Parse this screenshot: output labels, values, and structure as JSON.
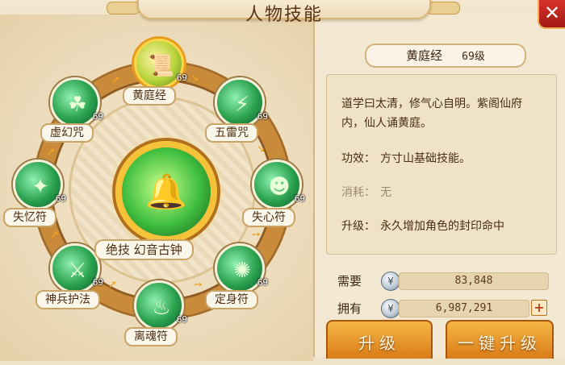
{
  "window": {
    "title": "人物技能",
    "close_icon": "close-icon"
  },
  "skill_wheel": {
    "skills": [
      {
        "name": "黄庭经",
        "level": "69",
        "icon": "scroll-icon",
        "selected": true
      },
      {
        "name": "五雷咒",
        "level": "69",
        "icon": "thunder-icon"
      },
      {
        "name": "失心符",
        "level": "69",
        "icon": "mask-icon"
      },
      {
        "name": "定身符",
        "level": "69",
        "icon": "bind-icon"
      },
      {
        "name": "离魂符",
        "level": "69",
        "icon": "soul-icon"
      },
      {
        "name": "神兵护法",
        "level": "69",
        "icon": "weapon-icon"
      },
      {
        "name": "失忆符",
        "level": "69",
        "icon": "talisman-icon"
      },
      {
        "name": "虚幻咒",
        "level": "69",
        "icon": "illusion-icon"
      }
    ],
    "ultimate": {
      "label": "绝技  幻音古钟",
      "icon": "bell-icon"
    }
  },
  "detail": {
    "title": "黄庭经",
    "level": "69级",
    "description": "道学曰太清，修气心自明。紫阁仙府内，仙人诵黄庭。",
    "effect_label": "功效：",
    "effect_value": "方寸山基础技能。",
    "cost_label": "消耗：",
    "cost_value": "无",
    "upgrade_label": "升级：",
    "upgrade_value": "永久增加角色的封印命中"
  },
  "resources": {
    "required_label": "需要",
    "required_value": "83,848",
    "owned_label": "拥有",
    "owned_value": "6,987,291"
  },
  "buttons": {
    "upgrade": "升级",
    "one_click_upgrade": "一键升级"
  },
  "colors": {
    "accent": "#d97b17",
    "ring": "#c98b3a",
    "skill_green": "#2aa24f"
  }
}
